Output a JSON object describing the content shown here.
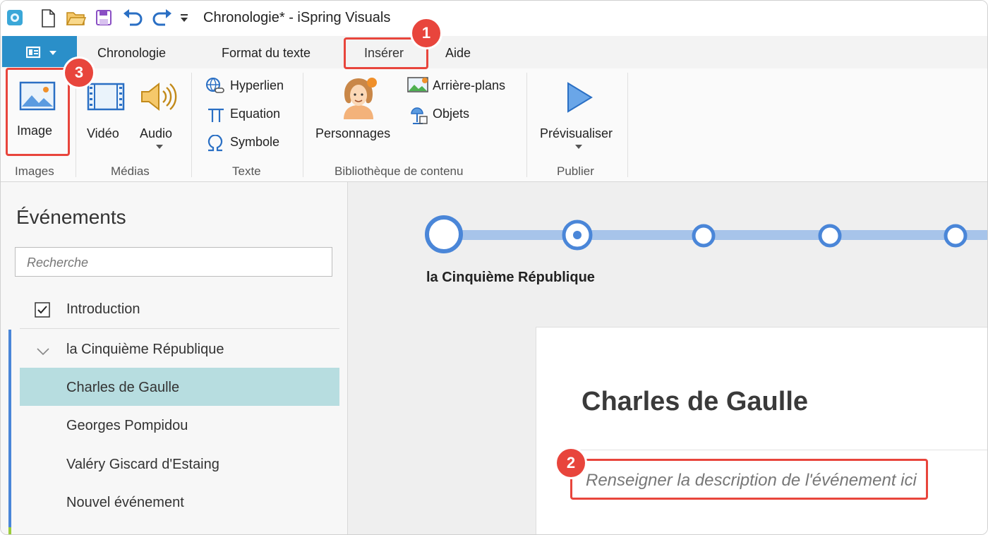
{
  "window": {
    "title": "Chronologie* - iSpring Visuals"
  },
  "tabs": [
    "Chronologie",
    "Format du texte",
    "Insérer",
    "Aide"
  ],
  "ribbon": {
    "images_group": {
      "image": "Image",
      "label": "Images"
    },
    "media_group": {
      "video": "Vidéo",
      "audio": "Audio",
      "label": "Médias"
    },
    "text_group": {
      "hyperlink": "Hyperlien",
      "equation": "Equation",
      "symbol": "Symbole",
      "label": "Texte"
    },
    "library_group": {
      "characters": "Personnages",
      "backgrounds": "Arrière-plans",
      "objects": "Objets",
      "label": "Bibliothèque de contenu"
    },
    "publish_group": {
      "preview": "Prévisualiser",
      "label": "Publier"
    }
  },
  "panel": {
    "title": "Événements",
    "search_placeholder": "Recherche",
    "intro": "Introduction",
    "group": "la Cinquième République",
    "events": [
      "Charles de Gaulle",
      "Georges Pompidou",
      "Valéry Giscard d'Estaing",
      "Nouvel événement"
    ]
  },
  "timeline": {
    "label": "la Cinquième République"
  },
  "card": {
    "title": "Charles de Gaulle",
    "description_placeholder": "Renseigner la description de l'événement ici"
  },
  "callouts": [
    "1",
    "2",
    "3"
  ],
  "colors": {
    "accent": "#2a8fc9",
    "callout": "#e8453c",
    "selection": "#b7dde0",
    "timeline": "#4a86d8"
  }
}
